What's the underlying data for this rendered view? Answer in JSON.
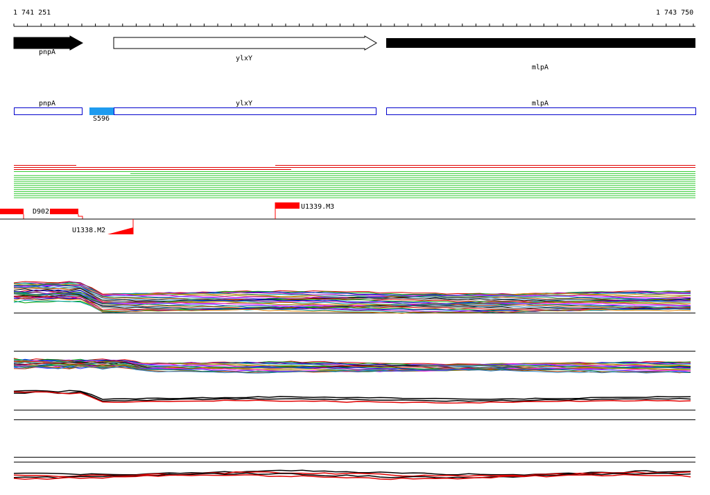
{
  "coordinates": {
    "start_label": "1 741 251",
    "end_label": "1 743 750"
  },
  "genes": [
    {
      "name": "pnpA",
      "label": "pnpA",
      "fill": "#000000",
      "strand": "+"
    },
    {
      "name": "ylxY",
      "label": "ylxY",
      "fill": "#ffffff",
      "strand": "+"
    },
    {
      "name": "mlpA",
      "label": "mlpA",
      "fill": "#000000",
      "strand": "+"
    }
  ],
  "annotation_track": {
    "outline_color": "#0000cc",
    "items": [
      {
        "label": "pnpA"
      },
      {
        "label": "ylxY"
      },
      {
        "label": "mlpA"
      }
    ],
    "feature": {
      "label": "S596",
      "color": "#1e9bef"
    }
  },
  "segments": {
    "color": "#ff0000",
    "labels": {
      "d902": "D902",
      "u1339": "U1339.M3",
      "u1338": "U1338.M2"
    }
  },
  "colors": {
    "green_lines": "#33cc33",
    "red_lines": "#e00000",
    "accent_red": "#ff0000"
  }
}
